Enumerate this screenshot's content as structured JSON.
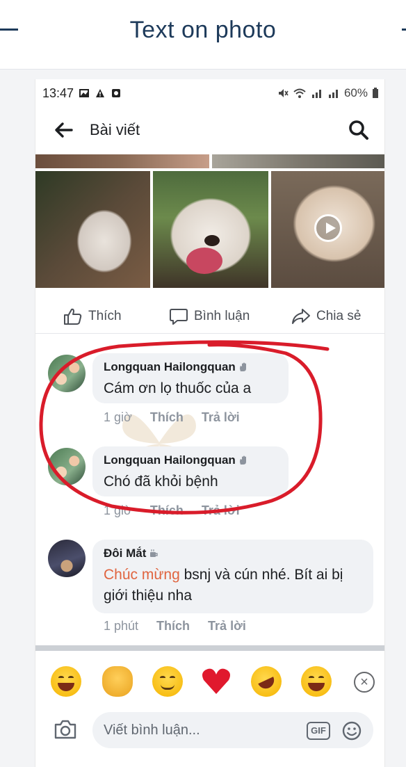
{
  "outer_header": {
    "title": "Text on photo"
  },
  "status_bar": {
    "time": "13:47",
    "battery": "60%"
  },
  "nav": {
    "title": "Bài viết"
  },
  "post_actions": {
    "like": "Thích",
    "comment": "Bình luận",
    "share": "Chia sẻ"
  },
  "comments": [
    {
      "author": "Longquan Hailongquan",
      "text": "Cám ơn lọ thuốc của a",
      "time": "1 giờ",
      "like": "Thích",
      "reply": "Trả lời"
    },
    {
      "author": "Longquan Hailongquan",
      "text": "Chó đã khỏi bệnh",
      "time": "1 giờ",
      "like": "Thích",
      "reply": "Trả lời"
    },
    {
      "author": "Đôi Mắt",
      "text_highlight": "Chúc mừng",
      "text_rest": " bsnj và cún nhé. Bít ai bị giới thiệu nha",
      "time": "1 phút",
      "like": "Thích",
      "reply": "Trả lời"
    }
  ],
  "composer": {
    "placeholder": "Viết bình luận...",
    "gif_label": "GIF"
  },
  "reactions": [
    "grinning-face",
    "clapping-hands",
    "smiling-face",
    "red-heart",
    "rolling-laughing-face",
    "tears-of-joy-face"
  ],
  "colors": {
    "annotation": "#d91c2a",
    "highlight": "#e0643f",
    "header_text": "#1d3a5a"
  }
}
